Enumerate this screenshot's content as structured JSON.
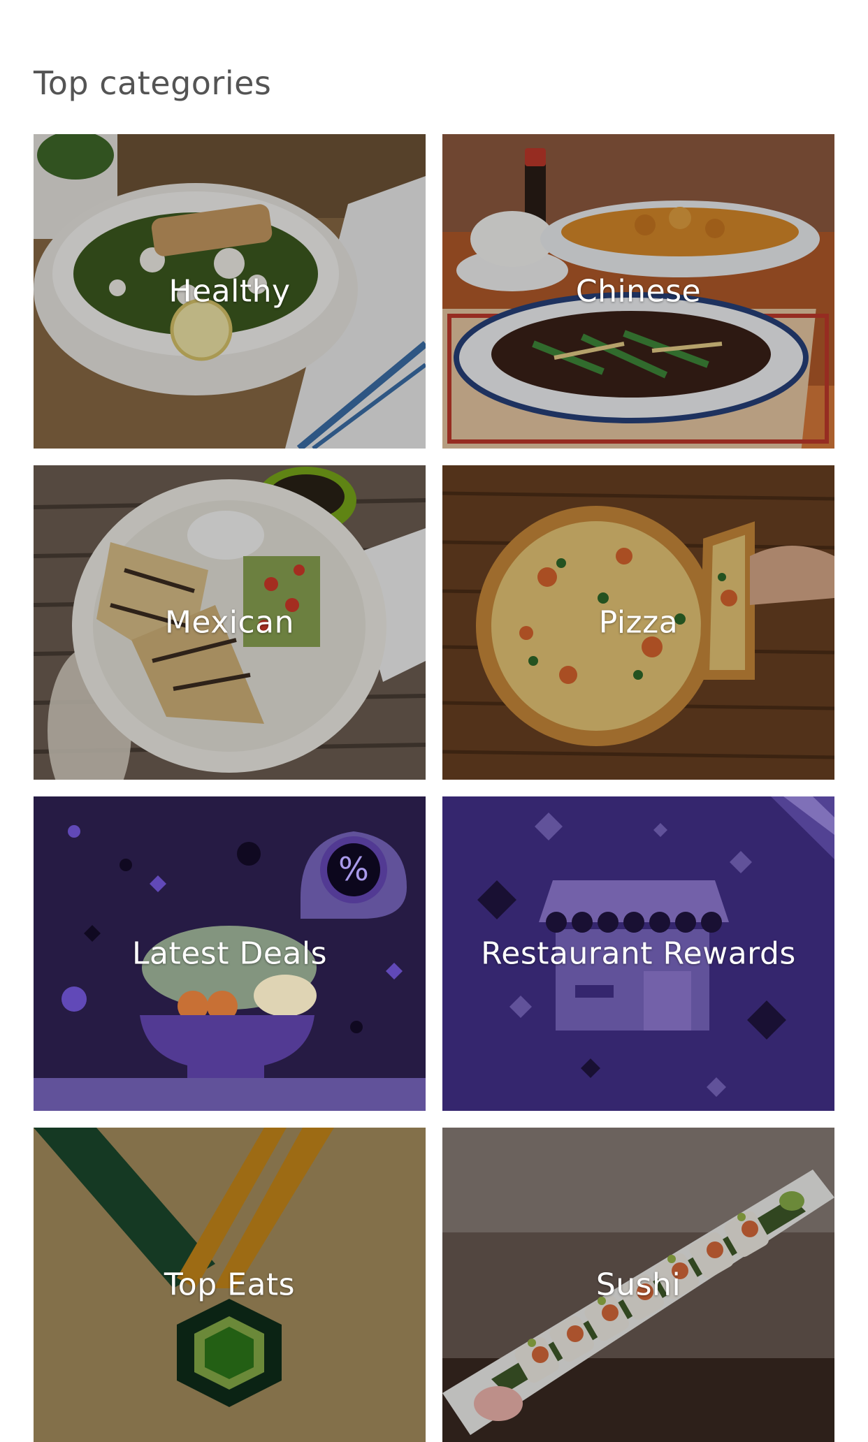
{
  "section": {
    "title": "Top categories"
  },
  "categories": [
    {
      "label": "Healthy"
    },
    {
      "label": "Chinese"
    },
    {
      "label": "Mexican"
    },
    {
      "label": "Pizza"
    },
    {
      "label": "Latest Deals",
      "badge": "%"
    },
    {
      "label": "Restaurant Rewards"
    },
    {
      "label": "Top Eats"
    },
    {
      "label": "Sushi"
    }
  ],
  "colors": {
    "deals_bg": "#2a1e4a",
    "rewards_bg": "#3a2a78",
    "topeats_bg": "#a8905f",
    "accent_purple": "#5a3fa0"
  }
}
